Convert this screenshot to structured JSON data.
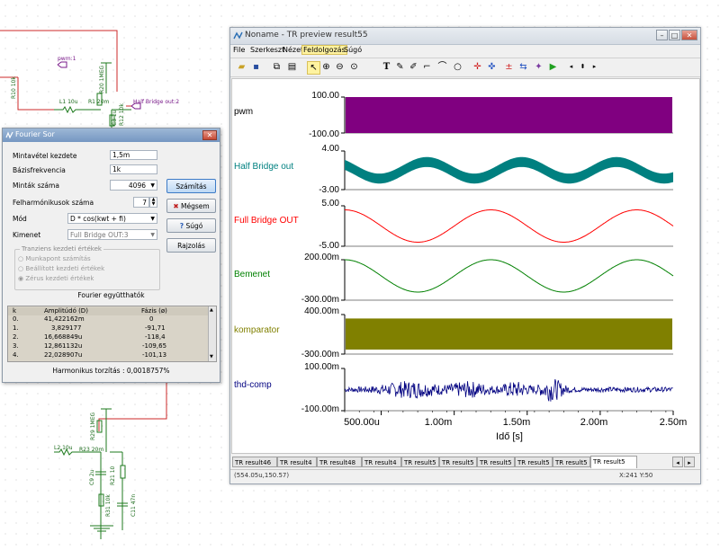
{
  "schematic": {
    "labels": [
      "pwm:1",
      "L1 10u",
      "R1 20m",
      "R20 1MEG",
      "Half Bridge out:2",
      "R10 10k",
      "C3 1u",
      "R12 10k",
      "L2 10u",
      "R23 20m",
      "R29 1MEG",
      "C9 2u",
      "R21 10",
      "R31 10k",
      "C11 47n"
    ]
  },
  "tr_window": {
    "title": "Noname - TR preview result55",
    "menu": [
      "File",
      "Szerkeszt",
      "Nézet",
      "Feldolgozás",
      "Súgó"
    ],
    "active_menu": "Feldolgozás",
    "tool_icons": [
      "open-icon",
      "save-icon",
      "copy-icon",
      "paste-icon",
      "pointer-icon",
      "zoom-in-icon",
      "zoom-out-icon",
      "zoom-fit-icon",
      "text-icon",
      "cursor-a-icon",
      "cursor-b-icon",
      "line-icon",
      "curve-icon",
      "ellipse-icon",
      "marker-icon",
      "marker2-icon",
      "plus-minus-icon",
      "arrows-icon",
      "wand-icon",
      "run-icon",
      "prev-icon",
      "updown-icon",
      "next-icon"
    ],
    "tabs": [
      "TR result46",
      "TR result4",
      "TR result48",
      "TR result4",
      "TR result5",
      "TR result5",
      "TR result5",
      "TR result5",
      "TR result5",
      "TR result5"
    ],
    "active_tab": "TR result5",
    "status_left": "(554.05u,150.57)",
    "status_right": "X:241  Y:50",
    "xlabel": "Idő [s]",
    "x_ticks": [
      "500.00u",
      "1.00m",
      "1.50m",
      "2.00m",
      "2.50m"
    ]
  },
  "chart_data": {
    "type": "line",
    "xlabel": "Idő [s]",
    "xlim": [
      0.00025,
      0.0025
    ],
    "x_ticks": [
      0.0005,
      0.001,
      0.0015,
      0.002,
      0.0025
    ],
    "channels": [
      {
        "name": "pwm",
        "color": "#800080",
        "ymax_label": "100.00",
        "ymin_label": "-100.00",
        "ylim": [
          -100,
          100
        ],
        "kind": "band",
        "band": [
          -100,
          100
        ]
      },
      {
        "name": "Half Bridge out",
        "color": "#008080",
        "ymax_label": "4.00",
        "ymin_label": "-3.00",
        "ylim": [
          -3,
          4
        ],
        "kind": "thick-sine",
        "amplitude": 1.5,
        "offset": 0.5,
        "band_half": 0.9,
        "period": 0.00065
      },
      {
        "name": "Full Bridge OUT",
        "color": "#ff0000",
        "ymax_label": "5.00",
        "ymin_label": "-5.00",
        "ylim": [
          -5,
          5
        ],
        "kind": "sine",
        "amplitude": 4,
        "period": 0.001
      },
      {
        "name": "Bemenet",
        "color": "#008000",
        "ymax_label": "200.00m",
        "ymin_label": "-300.00m",
        "ylim": [
          -0.3,
          0.2
        ],
        "kind": "sine",
        "amplitude": 0.2,
        "period": 0.001
      },
      {
        "name": "komparator",
        "color": "#808000",
        "ymax_label": "400.00m",
        "ymin_label": "-300.00m",
        "ylim": [
          -0.3,
          0.4
        ],
        "kind": "band",
        "band": [
          -0.22,
          0.33
        ]
      },
      {
        "name": "thd-comp",
        "color": "#000080",
        "ymax_label": "100.00m",
        "ymin_label": "-100.00m",
        "ylim": [
          -0.1,
          0.1
        ],
        "kind": "noise"
      }
    ]
  },
  "fourier": {
    "title": "Fourier Sor",
    "fields": [
      {
        "label": "Mintavétel kezdete",
        "value": "1,5m"
      },
      {
        "label": "Bázisfrekvencia",
        "value": "1k"
      },
      {
        "label": "Minták száma",
        "value": "4096"
      },
      {
        "label": "Felharmónikusok száma",
        "value": "7"
      },
      {
        "label": "Mód",
        "value": "D * cos(kwt + fi)"
      },
      {
        "label": "Kimenet",
        "value": "Full Bridge OUT:3"
      }
    ],
    "buttons": {
      "calc": "Számítás",
      "cancel": "Mégsem",
      "help": "Súgó",
      "plot": "Rajzolás"
    },
    "group_title": "Tranziens kezdeti értékek",
    "radios": [
      "Munkapont számítás",
      "Beállított kezdeti értékek",
      "Zérus kezdeti értékek"
    ],
    "coeff_title": "Fourier együtthatók",
    "table": {
      "headers": [
        "k",
        "Amplitúdó (D)",
        "Fázis (ø)"
      ],
      "rows": [
        [
          "0.",
          "41,422162m",
          "0"
        ],
        [
          "1.",
          "3,829177",
          "-91,71"
        ],
        [
          "2.",
          "16,668849u",
          "-118,4"
        ],
        [
          "3.",
          "12,861132u",
          "-109,65"
        ],
        [
          "4.",
          "22,028907u",
          "-101,13"
        ]
      ]
    },
    "thd": "Harmonikus torzítás : 0,0018757%"
  }
}
